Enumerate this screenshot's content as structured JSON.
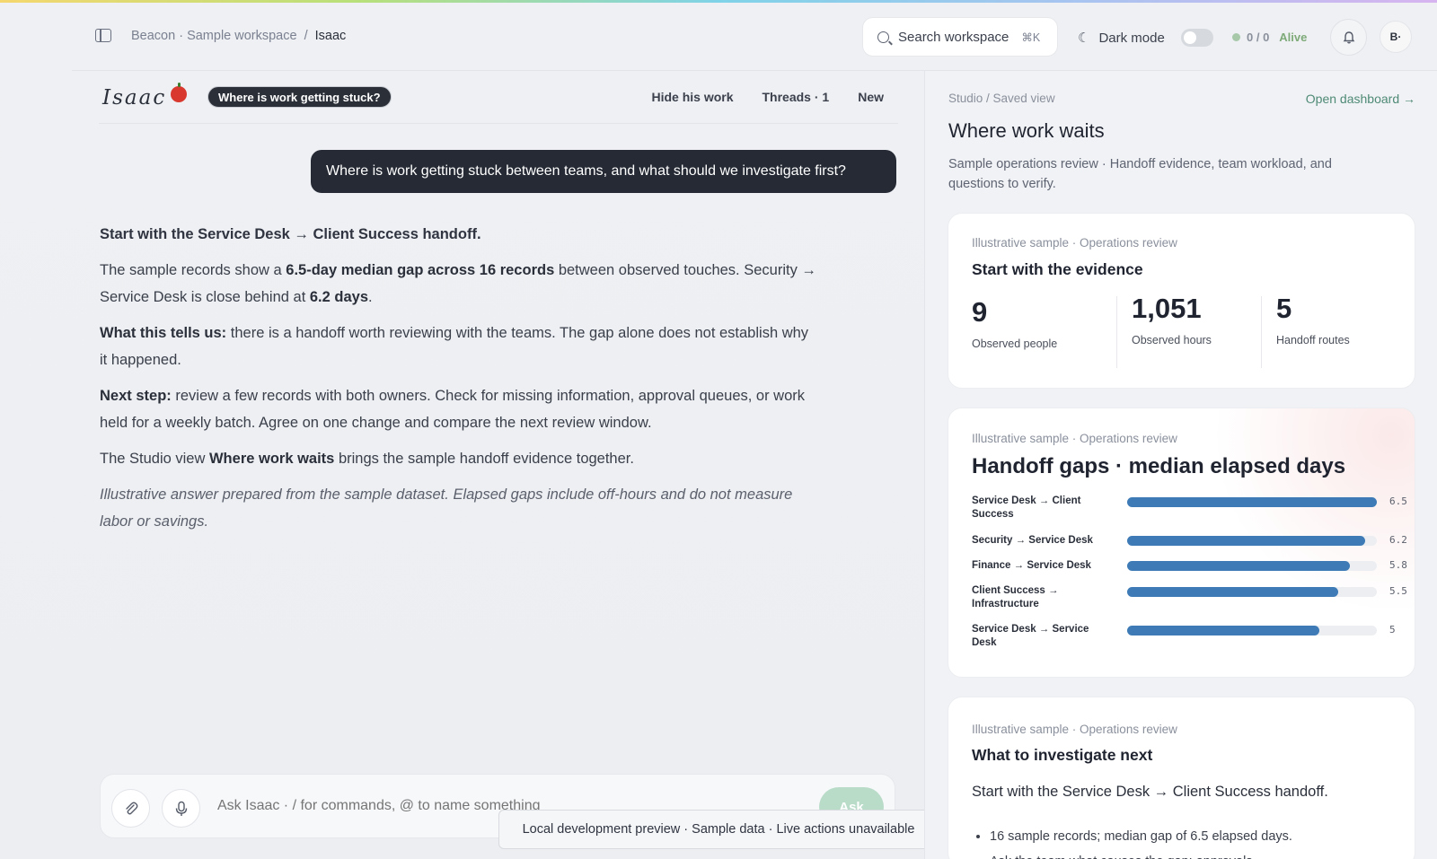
{
  "topbar": {
    "breadcrumb_workspace": "Beacon · Sample workspace",
    "breadcrumb_sep": "/",
    "breadcrumb_current": "Isaac",
    "search_label": "Search workspace",
    "search_shortcut": "⌘K",
    "dark_mode_label": "Dark mode",
    "status_count": "0 / 0",
    "status_label": "Alive",
    "avatar_initials": "B·"
  },
  "chat": {
    "logo_text": "Isaac",
    "topic_pill": "Where is work getting stuck?",
    "actions": [
      "Hide his work",
      "Threads · 1",
      "New"
    ],
    "user_message": "Where is work getting stuck between teams, and what should we investigate first?",
    "answer": {
      "lead": "Start with the Service Desk → Client Success handoff.",
      "p1_a": "The sample records show a ",
      "p1_b": "6.5-day median gap across 16 records",
      "p1_c": " between observed touches. Security → Service Desk is close behind at ",
      "p1_d": "6.2 days",
      "p1_e": ".",
      "p2_label": "What this tells us:",
      "p2_text": " there is a handoff worth reviewing with the teams. The gap alone does not establish why it happened.",
      "p3_label": "Next step:",
      "p3_text": " review a few records with both owners. Check for missing information, approval queues, or work held for a weekly batch. Agree on one change and compare the next review window.",
      "p4_a": "The Studio view ",
      "p4_b": "Where work waits",
      "p4_c": " brings the sample handoff evidence together.",
      "note": "Illustrative answer prepared from the sample dataset. Elapsed gaps include off-hours and do not measure labor or savings."
    },
    "composer_placeholder": "Ask Isaac · / for commands, @ to name something",
    "ask_label": "Ask",
    "toast": "Local development preview · Sample data · Live actions unavailable"
  },
  "studio": {
    "crumb": "Studio / Saved view",
    "open_dashboard": "Open dashboard →",
    "title": "Where work waits",
    "subtitle": "Sample operations review · Handoff evidence, team workload, and questions to verify.",
    "card1": {
      "kicker": "Illustrative sample · Operations review",
      "title": "Start with the evidence",
      "stats": [
        {
          "value": "9",
          "label": "Observed people"
        },
        {
          "value": "1,051",
          "label": "Observed hours"
        },
        {
          "value": "5",
          "label": "Handoff routes"
        }
      ]
    },
    "card2": {
      "kicker": "Illustrative sample · Operations review",
      "title": "Handoff gaps · median elapsed days"
    },
    "card3": {
      "kicker": "Illustrative sample · Operations review",
      "title": "What to investigate next",
      "lead": "Start with the Service Desk → Client Success handoff.",
      "bullets": [
        "16 sample records; median gap of 6.5 elapsed days.",
        "Ask the team what causes the gap: approvals,"
      ]
    }
  },
  "chart_data": {
    "type": "bar",
    "orientation": "horizontal",
    "title": "Handoff gaps · median elapsed days",
    "categories": [
      "Service Desk → Client Success",
      "Security → Service Desk",
      "Finance → Service Desk",
      "Client Success → Infrastructure",
      "Service Desk → Service Desk"
    ],
    "values": [
      6.5,
      6.2,
      5.8,
      5.5,
      5
    ],
    "value_labels": [
      "6.5",
      "6.2",
      "5.8",
      "5.5",
      "5"
    ],
    "xlim": [
      0,
      6.5
    ],
    "bar_color": "#3e7bb6"
  },
  "colors": {
    "accent_green": "#4e8a75",
    "status_green": "#7eaa79",
    "bubble_dark": "#252a34",
    "bar_blue": "#3e7bb6"
  },
  "icons": {
    "sidebar_toggle": "sidebar-icon",
    "search": "search-icon",
    "dark_mode": "moon-icon",
    "notifications": "bell-icon",
    "attach": "paperclip-icon",
    "voice": "microphone-icon"
  }
}
